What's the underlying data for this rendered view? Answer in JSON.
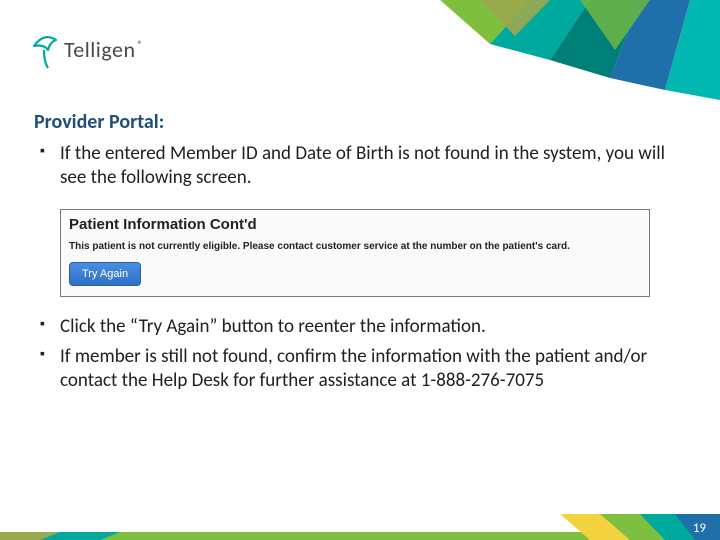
{
  "logo": {
    "name": "Telligen",
    "reg": "®"
  },
  "section_title": "Provider Portal:",
  "bullets_top": [
    "If the entered Member ID and Date of Birth is not found in the system, you will see the following screen."
  ],
  "screenshot": {
    "title": "Patient Information Cont'd",
    "message": "This patient is not currently eligible. Please contact customer service at the number on the patient's card.",
    "button_label": "Try Again"
  },
  "bullets_bottom": [
    "Click the “Try Again” button to reenter the information.",
    "If member is still not found, confirm the information with the patient and/or contact the Help Desk for further assistance at 1-888-276-7075"
  ],
  "page_number": "19",
  "colors": {
    "title": "#1f4e79",
    "accent_green": "#7fbf3f",
    "accent_teal": "#00a99d",
    "accent_teal_dark": "#007f78",
    "accent_blue": "#1f6fa8",
    "accent_yellow": "#f2d23e",
    "accent_olive": "#9aa84f",
    "logo_stroke": "#00a99d"
  }
}
